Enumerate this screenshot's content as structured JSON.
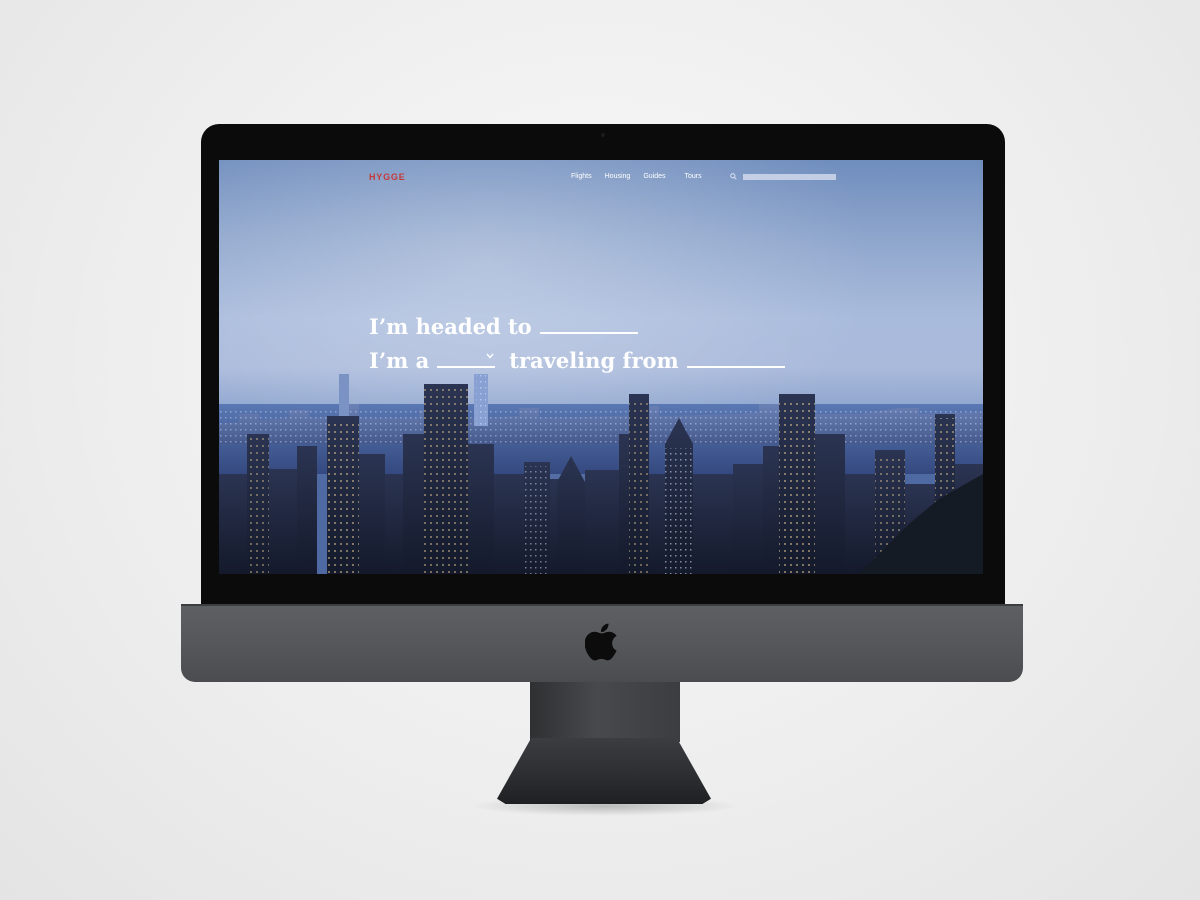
{
  "site": {
    "logo": "HYGGE",
    "nav": [
      {
        "label": "Flights"
      },
      {
        "label": "Housing"
      },
      {
        "label": "Guides"
      },
      {
        "label": "Tours"
      }
    ],
    "search": {
      "placeholder": ""
    }
  },
  "hero": {
    "line1_prefix": "I’m headed to",
    "line2_prefix": "I’m a",
    "line2_middle": "traveling from"
  },
  "colors": {
    "logo": "#c43a3a",
    "hero_text": "#ffffff"
  },
  "icons": [
    "search-icon",
    "chevron-down-icon",
    "apple-logo-icon"
  ]
}
